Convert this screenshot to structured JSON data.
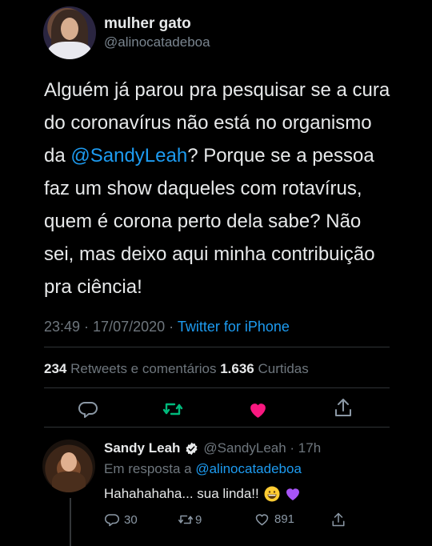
{
  "tweet": {
    "author_name": "mulher gato",
    "author_handle": "@alinocatadeboa",
    "text_before": "Alguém já parou pra pesquisar se a cura do coronavírus não está no organismo da ",
    "mention": "@SandyLeah",
    "text_after": "? Porque se a pessoa faz um show daqueles com rotavírus, quem é corona perto dela sabe? Não sei, mas deixo aqui minha contribuição pra ciência!",
    "time": "23:49 · 17/07/2020 · ",
    "source": "Twitter for iPhone",
    "retweets_count": "234",
    "retweets_label": " Retweets e comentários ",
    "likes_count": "1.636",
    "likes_label": " Curtidas"
  },
  "reply": {
    "name": "Sandy Leah",
    "handle_time": "@SandyLeah · 17h",
    "reply_prefix": "Em resposta a ",
    "reply_to": "@alinocatadeboa",
    "text": "Hahahahaha... sua linda!!",
    "reply_count": "30",
    "retweet_count": "9",
    "like_count": "891"
  },
  "colors": {
    "accent": "#1d9bf0",
    "retweet": "#00ba7c",
    "like": "#f91880",
    "background": "#000000"
  },
  "icons": [
    "reply-icon",
    "retweet-icon",
    "like-icon",
    "share-icon",
    "verified-icon"
  ]
}
